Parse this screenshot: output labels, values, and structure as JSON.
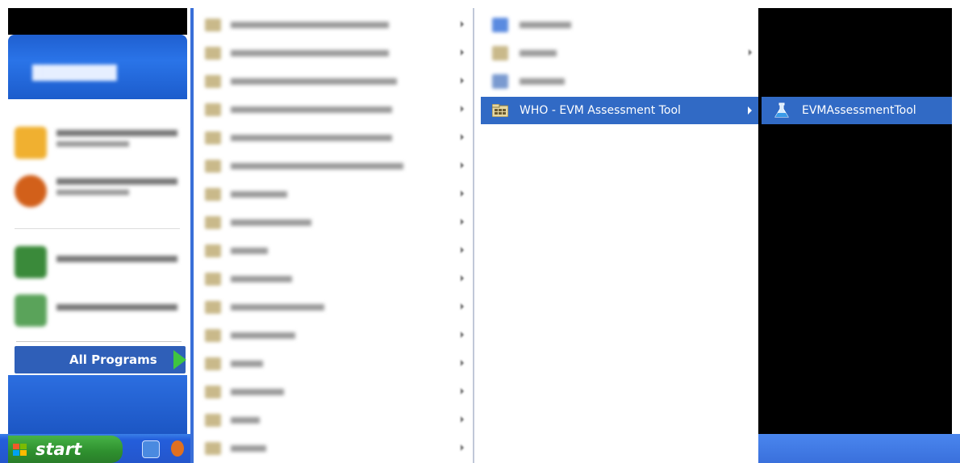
{
  "start_menu": {
    "all_programs_label": "All Programs"
  },
  "taskbar": {
    "start_label": "start"
  },
  "submenu": {
    "selected_folder_label": "WHO - EVM Assessment Tool"
  },
  "cascade_menu": {
    "selected_item_label": "EVMAssessmentTool"
  },
  "colors": {
    "selection_blue": "#316ac5",
    "start_green": "#3a9a3a",
    "xp_blue": "#245edb"
  },
  "icons": {
    "program_folder": "program-group-folder-icon",
    "app": "flask-app-icon",
    "start_flag": "windows-flag-icon"
  }
}
